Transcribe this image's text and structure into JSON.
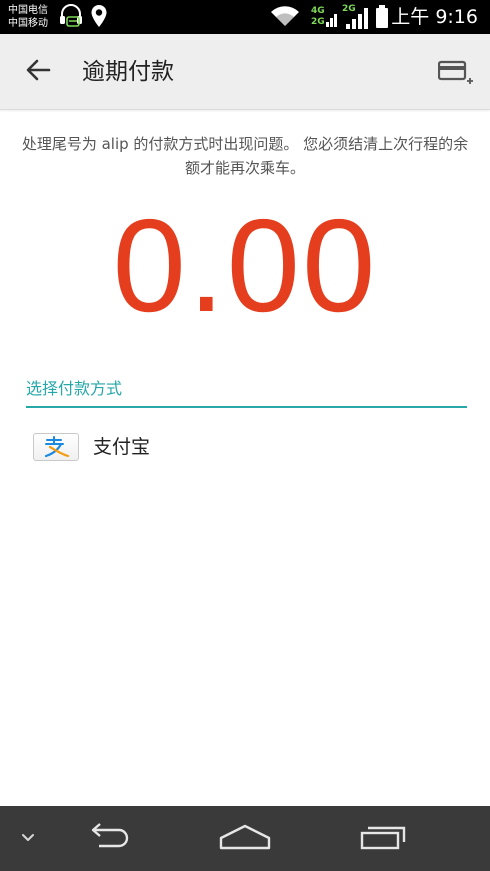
{
  "status_bar": {
    "carrier_1": "中国电信",
    "carrier_2": "中国移动",
    "network_4g": "4G",
    "network_2g": "2G",
    "time": "上午 9:16",
    "icons": [
      "headset-icon",
      "location-pin-icon",
      "wifi-icon",
      "signal-icon",
      "battery-icon"
    ]
  },
  "app_bar": {
    "title": "逾期付款",
    "back_icon": "arrow-left-icon",
    "add_card_icon": "add-card-icon"
  },
  "content": {
    "message": "处理尾号为 alip 的付款方式时出现问题。 您必须结清上次行程的余额才能再次乘车。",
    "amount": "0.00",
    "section_label": "选择付款方式",
    "payment_methods": [
      {
        "label": "支付宝",
        "icon": "alipay-logo-icon"
      }
    ]
  },
  "nav_bar": {
    "buttons": [
      "chevron-down-icon",
      "back-icon",
      "home-icon",
      "recent-apps-icon"
    ]
  },
  "colors": {
    "amount": "#e53e1e",
    "accent_teal": "#26a7a8",
    "app_bar_bg": "#eeeeee",
    "status_bar_bg": "#000000",
    "nav_bar_bg": "#3a3a3a",
    "alipay_blue": "#1a8ae0",
    "alipay_orange": "#f39c12"
  }
}
